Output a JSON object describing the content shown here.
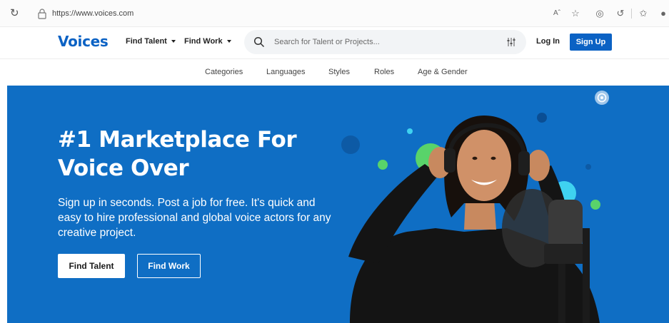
{
  "browser": {
    "url": "https://www.voices.com",
    "icons": [
      "reload-icon",
      "lock-icon",
      "read-aloud-icon",
      "favorite-add-icon",
      "extensions-icon",
      "copilot-icon",
      "favorites-icon",
      "profile-icon"
    ]
  },
  "header": {
    "logo": "Voices",
    "nav": [
      {
        "label": "Find Talent"
      },
      {
        "label": "Find Work"
      }
    ],
    "search_placeholder": "Search for Talent or Projects...",
    "login_label": "Log In",
    "signup_label": "Sign Up",
    "brand_color": "#0b62c4"
  },
  "subnav": {
    "items": [
      "Categories",
      "Languages",
      "Styles",
      "Roles",
      "Age & Gender"
    ]
  },
  "hero": {
    "title": "#1 Marketplace For Voice Over",
    "description": "Sign up in seconds. Post a job for free. It's quick and easy to hire professional and global voice actors for any creative project.",
    "primary_button": "Find Talent",
    "secondary_button": "Find Work",
    "background_color": "#0f6ec4",
    "accent_colors": [
      "#59d36a",
      "#3fd2f0",
      "#0a4e94"
    ]
  }
}
